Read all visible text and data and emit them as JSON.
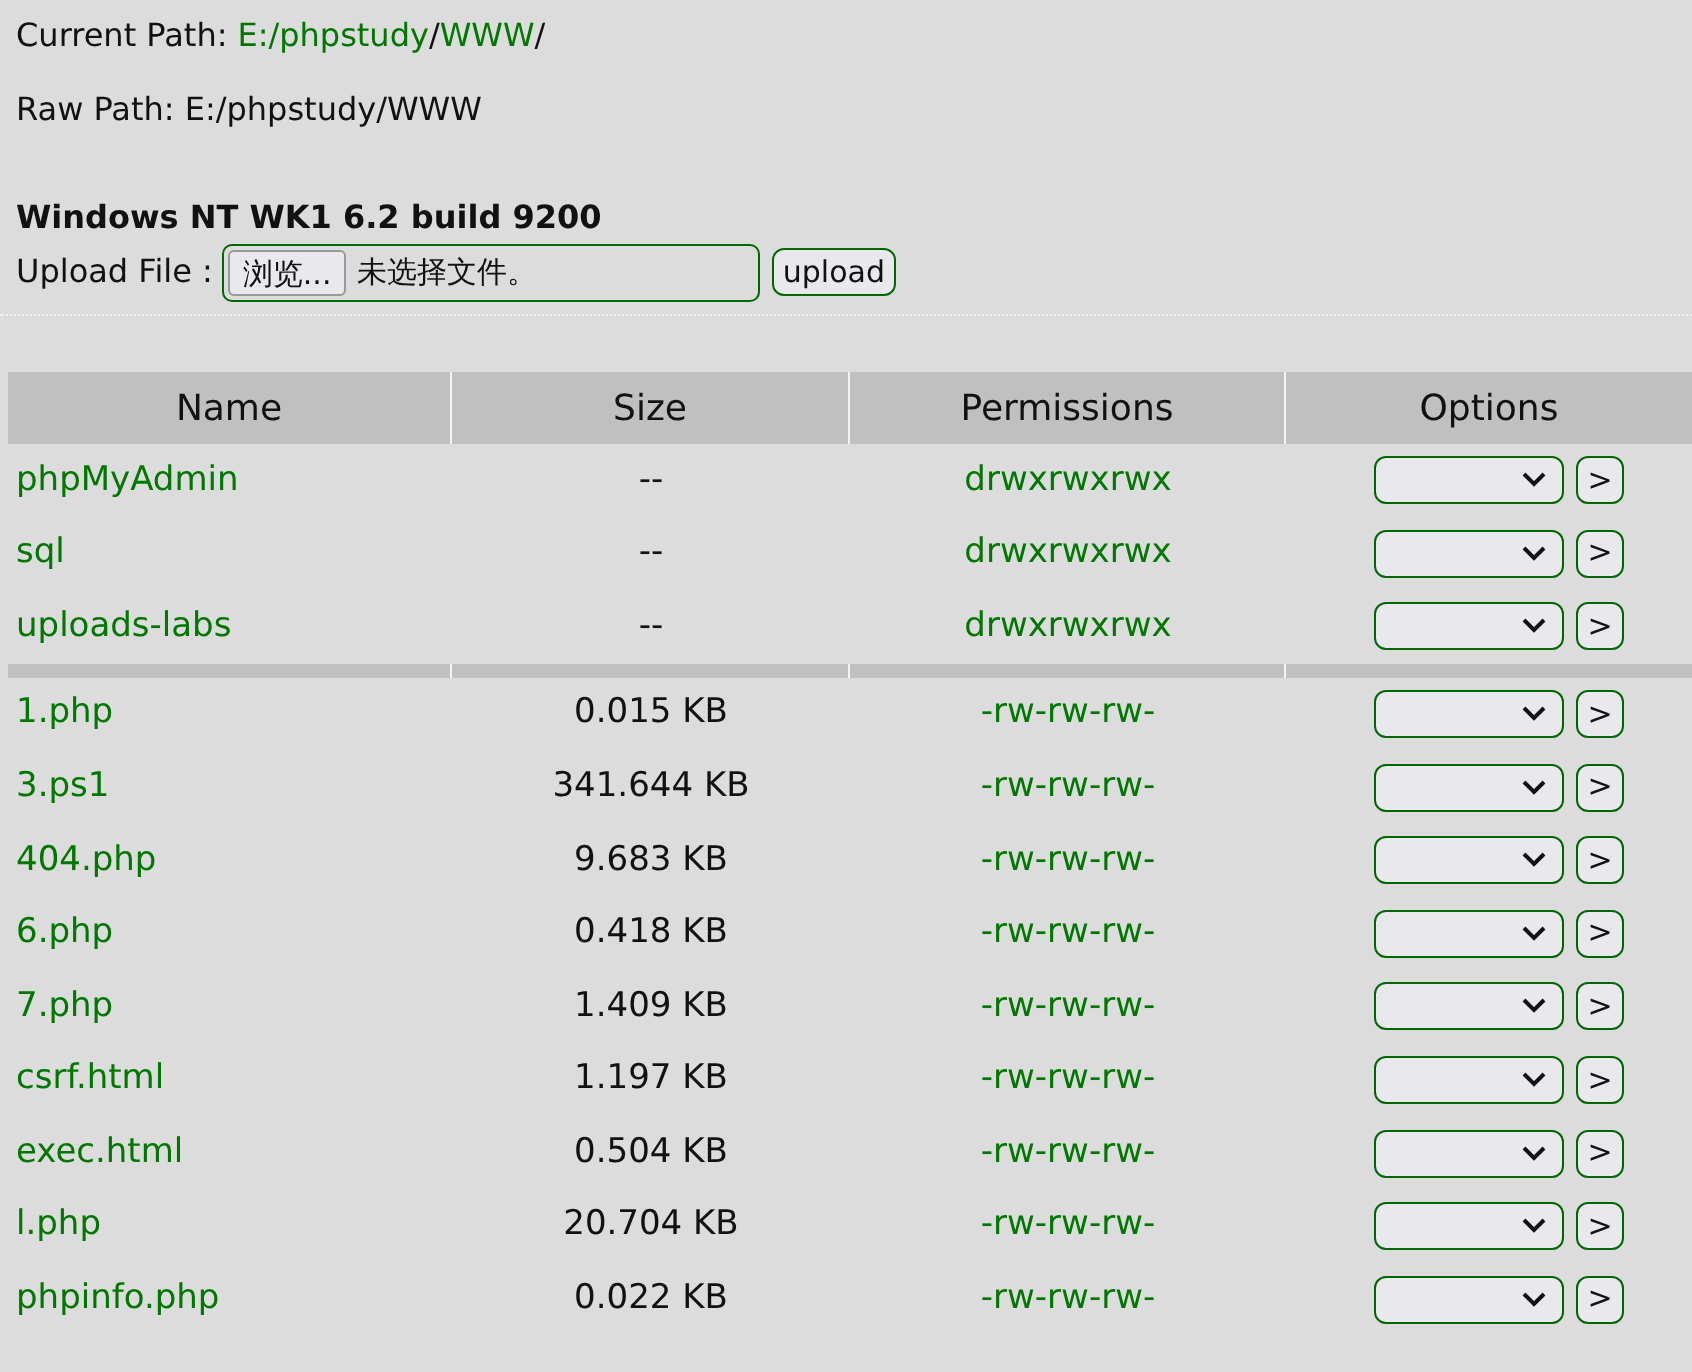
{
  "current_path": {
    "label": "Current Path:",
    "segments": [
      {
        "text": "E:/",
        "kind": "link"
      },
      {
        "text": "phpstudy",
        "kind": "link"
      },
      {
        "text": "/",
        "kind": "text"
      },
      {
        "text": "WWW",
        "kind": "link"
      },
      {
        "text": "/",
        "kind": "text"
      }
    ]
  },
  "raw_path": "Raw Path: E:/phpstudy/WWW",
  "system_info": "Windows NT WK1 6.2 build 9200",
  "upload": {
    "label": "Upload File :",
    "browse_button": "浏览...",
    "file_status": "未选择文件。",
    "upload_button": "upload"
  },
  "table": {
    "columns": [
      "Name",
      "Size",
      "Permissions",
      "Options"
    ],
    "directories": [
      {
        "name": "phpMyAdmin",
        "size": "--",
        "permissions": "drwxrwxrwx",
        "go": ">"
      },
      {
        "name": "sql",
        "size": "--",
        "permissions": "drwxrwxrwx",
        "go": ">"
      },
      {
        "name": "uploads-labs",
        "size": "--",
        "permissions": "drwxrwxrwx",
        "go": ">"
      }
    ],
    "files": [
      {
        "name": "1.php",
        "size": "0.015 KB",
        "permissions": "-rw-rw-rw-",
        "go": ">"
      },
      {
        "name": "3.ps1",
        "size": "341.644 KB",
        "permissions": "-rw-rw-rw-",
        "go": ">"
      },
      {
        "name": "404.php",
        "size": "9.683 KB",
        "permissions": "-rw-rw-rw-",
        "go": ">"
      },
      {
        "name": "6.php",
        "size": "0.418 KB",
        "permissions": "-rw-rw-rw-",
        "go": ">"
      },
      {
        "name": "7.php",
        "size": "1.409 KB",
        "permissions": "-rw-rw-rw-",
        "go": ">"
      },
      {
        "name": "csrf.html",
        "size": "1.197 KB",
        "permissions": "-rw-rw-rw-",
        "go": ">"
      },
      {
        "name": "exec.html",
        "size": "0.504 KB",
        "permissions": "-rw-rw-rw-",
        "go": ">"
      },
      {
        "name": "l.php",
        "size": "20.704 KB",
        "permissions": "-rw-rw-rw-",
        "go": ">"
      },
      {
        "name": "phpinfo.php",
        "size": "0.022 KB",
        "permissions": "-rw-rw-rw-",
        "go": ">"
      }
    ]
  }
}
